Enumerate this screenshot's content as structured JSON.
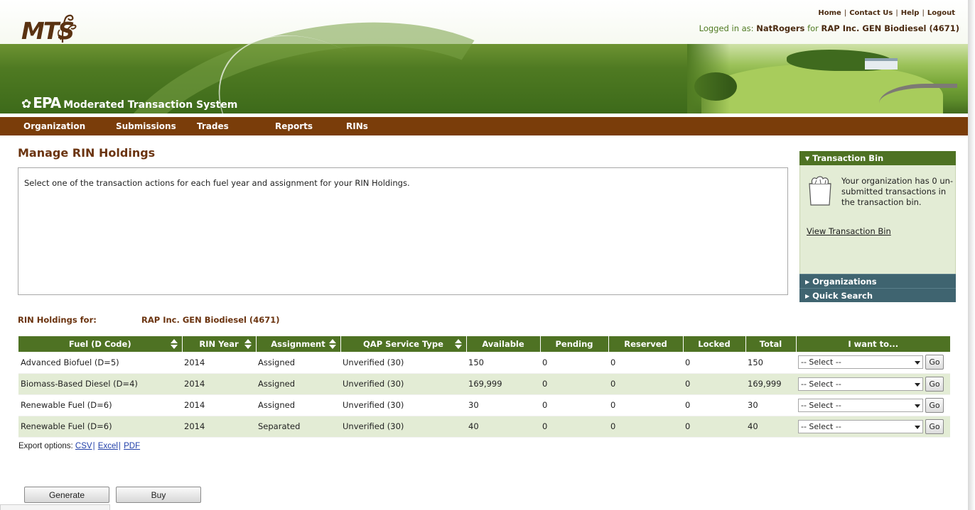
{
  "header": {
    "logo_text": "MTS",
    "agency": "EPA",
    "system_name": "Moderated Transaction System",
    "top_links": [
      "Home",
      "Contact Us",
      "Help",
      "Logout"
    ],
    "logged_in_prefix": "Logged in as:",
    "user": "NatRogers",
    "for_word": "for",
    "organization": "RAP Inc. GEN Biodiesel (4671)"
  },
  "nav": [
    "Organization",
    "Submissions",
    "Trades",
    "Reports",
    "RINs"
  ],
  "page": {
    "title": "Manage RIN Holdings",
    "instructions": "Select one of the transaction actions for each fuel year and assignment for your RIN Holdings."
  },
  "side": {
    "transaction_bin": "Transaction Bin",
    "bin_message": "Your organization has 0 un-submitted transactions in the transaction bin.",
    "view_link": "View Transaction Bin",
    "organizations": "Organizations",
    "quick_search": "Quick Search"
  },
  "holdings": {
    "label": "RIN Holdings for:",
    "org": "RAP Inc. GEN Biodiesel (4671)",
    "columns": [
      "Fuel (D Code)",
      "RIN Year",
      "Assignment",
      "QAP Service Type",
      "Available",
      "Pending",
      "Reserved",
      "Locked",
      "Total",
      "I want to..."
    ],
    "rows": [
      {
        "fuel": "Advanced Biofuel (D=5)",
        "year": "2014",
        "assignment": "Assigned",
        "qap": "Unverified (30)",
        "available": "150",
        "pending": "0",
        "reserved": "0",
        "locked": "0",
        "total": "150",
        "action": "-- Select --",
        "go": "Go"
      },
      {
        "fuel": "Biomass-Based Diesel (D=4)",
        "year": "2014",
        "assignment": "Assigned",
        "qap": "Unverified (30)",
        "available": "169,999",
        "pending": "0",
        "reserved": "0",
        "locked": "0",
        "total": "169,999",
        "action": "-- Select --",
        "go": "Go"
      },
      {
        "fuel": "Renewable Fuel (D=6)",
        "year": "2014",
        "assignment": "Assigned",
        "qap": "Unverified (30)",
        "available": "30",
        "pending": "0",
        "reserved": "0",
        "locked": "0",
        "total": "30",
        "action": "-- Select --",
        "go": "Go"
      },
      {
        "fuel": "Renewable Fuel (D=6)",
        "year": "2014",
        "assignment": "Separated",
        "qap": "Unverified (30)",
        "available": "40",
        "pending": "0",
        "reserved": "0",
        "locked": "0",
        "total": "40",
        "action": "-- Select --",
        "go": "Go"
      }
    ]
  },
  "export": {
    "label": "Export options:",
    "csv": "CSV",
    "excel": "Excel",
    "pdf": "PDF"
  },
  "buttons": {
    "generate": "Generate",
    "buy": "Buy"
  },
  "colors": {
    "nav_brown": "#7a3d0a",
    "header_green": "#4e7223",
    "row_alt": "#e3ecd5",
    "panel_blue": "#3f6470"
  }
}
